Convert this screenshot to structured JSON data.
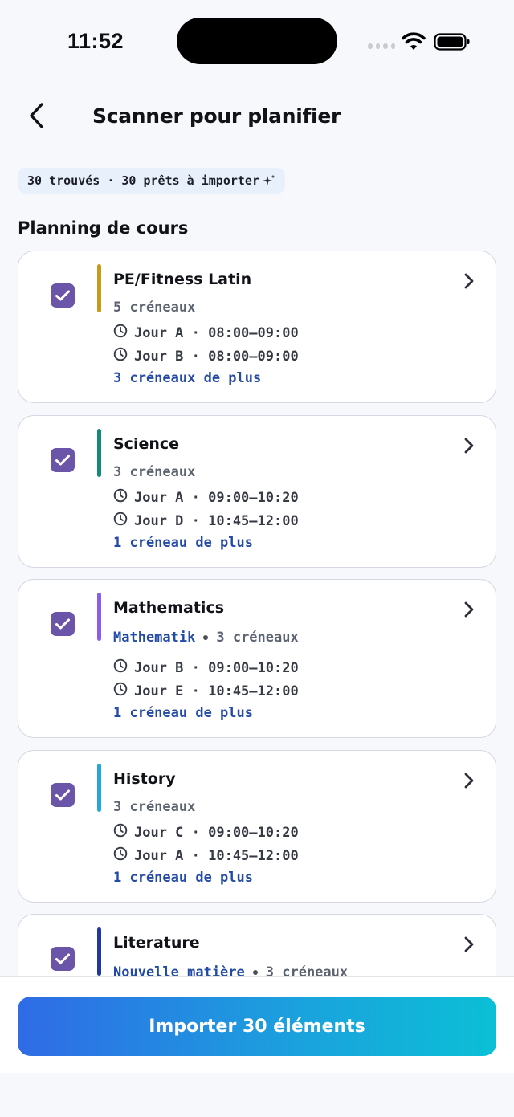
{
  "status": {
    "time": "11:52"
  },
  "header": {
    "title": "Scanner pour planifier"
  },
  "summary": {
    "text": "30 trouvés · 30 prêts à importer"
  },
  "section": {
    "title": "Planning de cours"
  },
  "courses": [
    {
      "title": "PE/Fitness Latin",
      "accent": "#c89a1a",
      "subject": "",
      "slots_count": "5 créneaux",
      "slots": [
        "Jour A · 08:00–09:00",
        "Jour B · 08:00–09:00"
      ],
      "more": "3 créneaux de plus"
    },
    {
      "title": "Science",
      "accent": "#138a7a",
      "subject": "",
      "slots_count": "3 créneaux",
      "slots": [
        "Jour A · 09:00–10:20",
        "Jour D · 10:45–12:00"
      ],
      "more": "1 créneau de plus"
    },
    {
      "title": "Mathematics",
      "accent": "#8a5cf0",
      "subject": "Mathematik",
      "slots_count": "3 créneaux",
      "slots": [
        "Jour B · 09:00–10:20",
        "Jour E · 10:45–12:00"
      ],
      "more": "1 créneau de plus"
    },
    {
      "title": "History",
      "accent": "#23a8d8",
      "subject": "",
      "slots_count": "3 créneaux",
      "slots": [
        "Jour C · 09:00–10:20",
        "Jour A · 10:45–12:00"
      ],
      "more": "1 créneau de plus"
    },
    {
      "title": "Literature",
      "accent": "#22389e",
      "subject": "Nouvelle matière",
      "slots_count": "3 créneaux",
      "slots": [],
      "more": ""
    }
  ],
  "footer": {
    "import_label": "Importer 30 éléments"
  },
  "colors": {
    "checkbox": "#6a55a8",
    "link": "#234aa6",
    "accent_button_start": "#2f6be6",
    "accent_button_end": "#0bbfd6"
  }
}
